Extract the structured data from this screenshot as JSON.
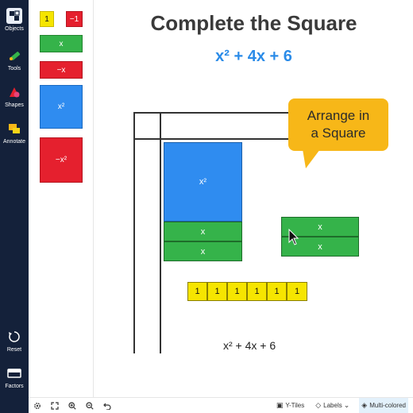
{
  "rail": {
    "items": [
      {
        "label": "Objects",
        "icon": "objects-icon"
      },
      {
        "label": "Tools",
        "icon": "tools-icon"
      },
      {
        "label": "Shapes",
        "icon": "shapes-icon"
      },
      {
        "label": "Annotate",
        "icon": "annotate-icon"
      },
      {
        "label": "Reset",
        "icon": "reset-icon"
      },
      {
        "label": "Factors",
        "icon": "factors-icon"
      }
    ]
  },
  "palette": {
    "tiles": [
      {
        "label": "1",
        "color": "yellow"
      },
      {
        "label": "−1",
        "color": "red"
      },
      {
        "label": "x",
        "color": "green"
      },
      {
        "label": "−x",
        "color": "red"
      },
      {
        "label": "x²",
        "color": "blue"
      },
      {
        "label": "−x²",
        "color": "red"
      }
    ]
  },
  "workspace": {
    "title": "Complete the Square",
    "expression": "x² + 4x + 6",
    "callout": {
      "line1": "Arrange in",
      "line2": "a Square"
    },
    "bottom_expression": "x² + 4x + 6",
    "placed": {
      "x_squared": "x²",
      "x_tile_1": "x",
      "x_tile_2": "x",
      "x_tile_3": "x",
      "x_tile_4": "x",
      "unit_tiles": [
        "1",
        "1",
        "1",
        "1",
        "1",
        "1"
      ]
    }
  },
  "toolbar": {
    "icons": [
      "settings-icon",
      "fullscreen-icon",
      "zoom-in-icon",
      "zoom-out-icon",
      "undo-icon"
    ],
    "ytiles_label": "Y-Tiles",
    "labels_label": "Labels",
    "colors_label": "Multi-colored"
  },
  "colors": {
    "rail_bg": "#14213a",
    "accent_blue": "#2a8be8",
    "tile_yellow": "#f6e500",
    "tile_red": "#e5202e",
    "tile_green": "#35b34a",
    "tile_blue": "#2f8cf0",
    "callout": "#f7b718"
  }
}
